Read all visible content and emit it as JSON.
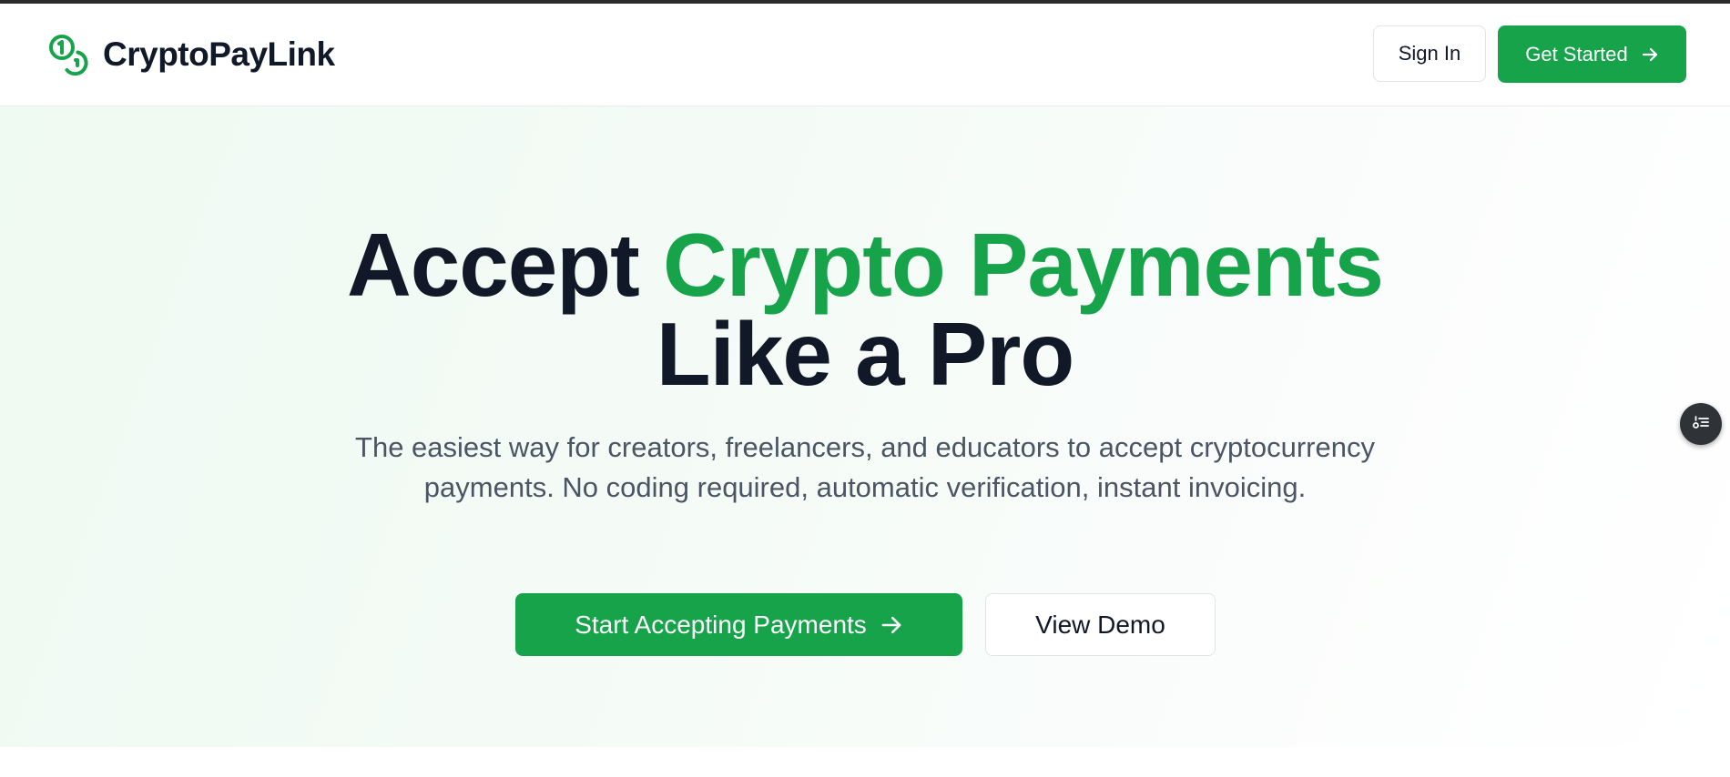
{
  "header": {
    "brand_name": "CryptoPayLink",
    "logo_icon": "coins-icon",
    "sign_in_label": "Sign In",
    "get_started_label": "Get Started"
  },
  "hero": {
    "title_part1": "Accept ",
    "title_accent": "Crypto Payments",
    "title_line2": "Like a Pro",
    "subtitle": "The easiest way for creators, freelancers, and educators to accept cryptocurrency payments. No coding required, automatic verification, instant invoicing.",
    "primary_cta_label": "Start Accepting Payments",
    "secondary_cta_label": "View Demo"
  },
  "floating_button": {
    "icon": "list-settings-icon"
  },
  "colors": {
    "accent": "#16a34a",
    "text_dark": "#111827",
    "text_muted": "#4b5563"
  }
}
